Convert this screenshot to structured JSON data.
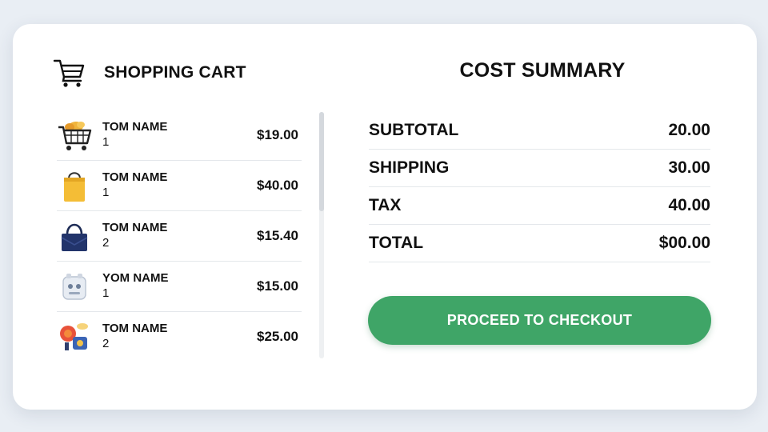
{
  "colors": {
    "accent": "#3fa567",
    "background": "#e9eef4",
    "card": "#ffffff"
  },
  "cart": {
    "icon": "cart-icon",
    "title": "SHOPPING CART",
    "items": [
      {
        "icon": "shopping-cart-food-icon",
        "name": "TOM NAME",
        "qty": "1",
        "price": "$19.00"
      },
      {
        "icon": "yellow-bag-icon",
        "name": "TOM NAME",
        "qty": "1",
        "price": "$40.00"
      },
      {
        "icon": "blue-handbag-icon",
        "name": "TOM NAME",
        "qty": "2",
        "price": "$15.40"
      },
      {
        "icon": "robot-box-icon",
        "name": "YOM NAME",
        "qty": "1",
        "price": "$15.00"
      },
      {
        "icon": "toy-set-icon",
        "name": "TOM NAME",
        "qty": "2",
        "price": "$25.00"
      }
    ]
  },
  "summary": {
    "title": "COST SUMMARY",
    "rows": [
      {
        "label": "SUBTOTAL",
        "value": "20.00"
      },
      {
        "label": "SHIPPING",
        "value": "30.00"
      },
      {
        "label": "TAX",
        "value": "40.00"
      },
      {
        "label": "TOTAL",
        "value": "$00.00"
      }
    ],
    "checkout_label": "PROCEED TO CHECKOUT"
  }
}
